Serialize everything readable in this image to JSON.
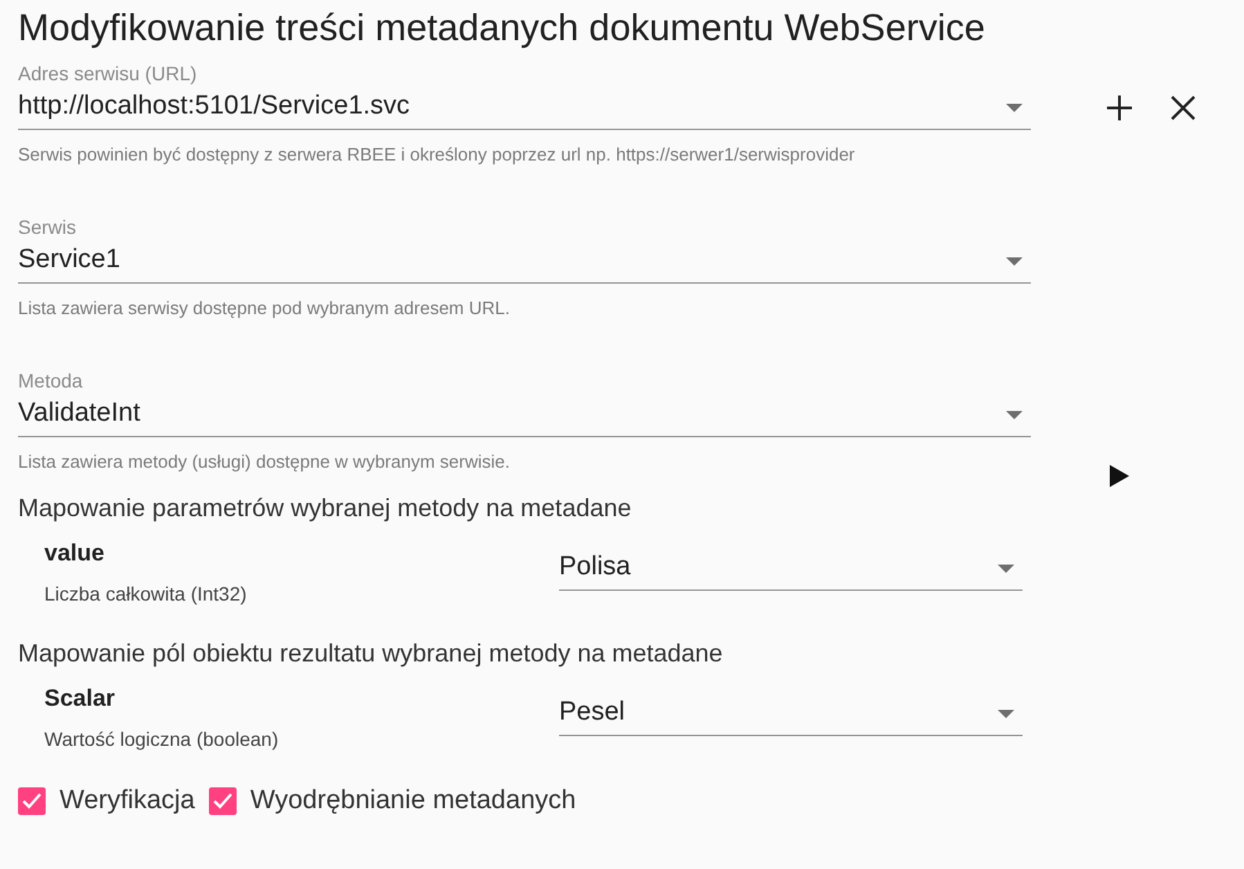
{
  "title": "Modyfikowanie treści metadanych dokumentu WebService",
  "fields": [
    {
      "label": "Adres serwisu (URL)",
      "value": "http://localhost:5101/Service1.svc",
      "hint": "Serwis powinien być dostępny z serwera RBEE i określony poprzez url np. https://serwer1/serwisprovider",
      "actions": [
        {
          "kind": "add"
        },
        {
          "kind": "close"
        }
      ]
    },
    {
      "label": "Serwis",
      "value": "Service1",
      "hint": "Lista zawiera serwisy dostępne pod wybranym adresem URL."
    },
    {
      "label": "Metoda",
      "value": "ValidateInt",
      "hint": "Lista zawiera metody (usługi) dostępne w wybranym serwisie.",
      "actions": [
        {
          "kind": "run"
        }
      ]
    }
  ],
  "sections": [
    {
      "heading": "Mapowanie parametrów wybranej metody na metadane",
      "items": [
        {
          "name": "value",
          "type": "Liczba całkowita (Int32)",
          "value": "Polisa"
        }
      ]
    },
    {
      "heading": "Mapowanie pól obiektu rezultatu wybranej metody na metadane",
      "items": [
        {
          "name": "Scalar",
          "type": "Wartość logiczna (boolean)",
          "value": "Pesel"
        }
      ]
    }
  ],
  "checkboxes": [
    {
      "label": "Weryfikacja",
      "checked": true
    },
    {
      "label": "Wyodrębnianie metadanych",
      "checked": true
    }
  ]
}
